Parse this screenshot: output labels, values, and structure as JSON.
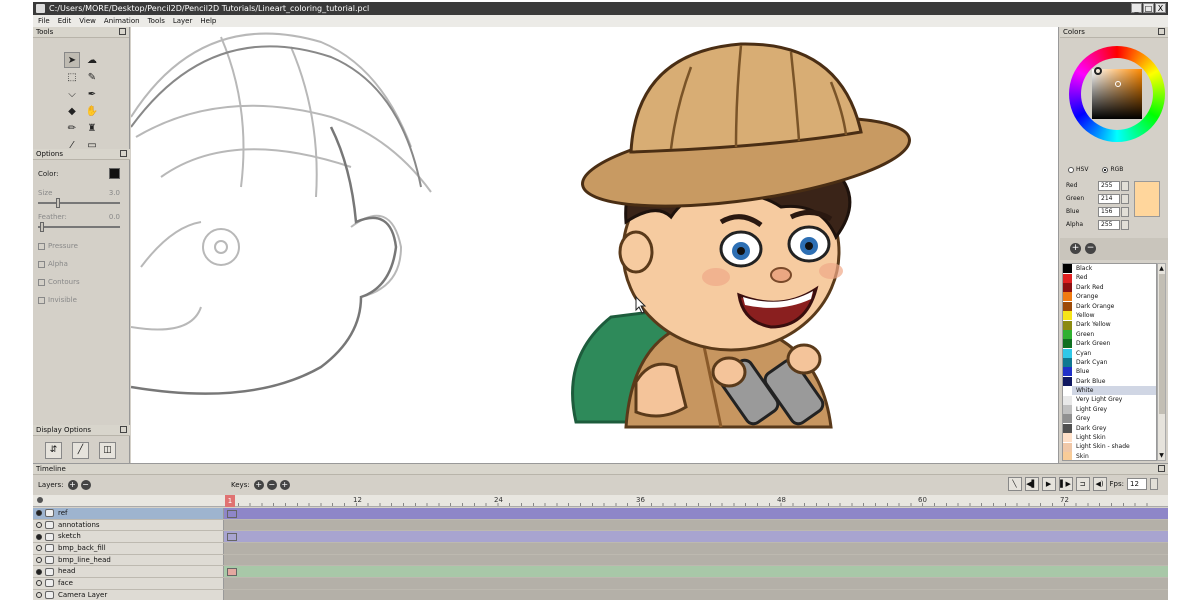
{
  "window": {
    "title": "C:/Users/MORE/Desktop/Pencil2D/Pencil2D Tutorials/Lineart_coloring_tutorial.pcl",
    "buttons": [
      "_",
      "□",
      "X"
    ]
  },
  "menu": [
    "File",
    "Edit",
    "View",
    "Animation",
    "Tools",
    "Layer",
    "Help"
  ],
  "tools_panel": {
    "title": "Tools",
    "tools": [
      {
        "name": "pointer",
        "icon": "arrow-icon",
        "glyph": "➤",
        "active": true
      },
      {
        "name": "smudge",
        "icon": "smudge-icon",
        "glyph": "☁",
        "active": false
      },
      {
        "name": "select",
        "icon": "select-icon",
        "glyph": "⬚",
        "active": false
      },
      {
        "name": "brush",
        "icon": "brush-icon",
        "glyph": "✎",
        "active": false
      },
      {
        "name": "polyline",
        "icon": "polyline-icon",
        "glyph": "⌵",
        "active": false
      },
      {
        "name": "pen",
        "icon": "pen-icon",
        "glyph": "✒",
        "active": false
      },
      {
        "name": "bucket",
        "icon": "bucket-icon",
        "glyph": "◆",
        "active": false
      },
      {
        "name": "hand",
        "icon": "hand-icon",
        "glyph": "✋",
        "active": false
      },
      {
        "name": "pencil",
        "icon": "pencil-icon",
        "glyph": "✏",
        "active": false
      },
      {
        "name": "stamp",
        "icon": "stamp-icon",
        "glyph": "♜",
        "active": false
      },
      {
        "name": "eyedropper",
        "icon": "eyedropper-icon",
        "glyph": "⁄",
        "active": false
      },
      {
        "name": "eraser",
        "icon": "eraser-icon",
        "glyph": "▭",
        "active": false
      }
    ]
  },
  "options_panel": {
    "title": "Options",
    "color_label": "Color:",
    "size_label": "Size",
    "size_value": "3.0",
    "feather_label": "Feather:",
    "feather_value": "0.0",
    "checks": [
      "Pressure",
      "Alpha",
      "Contours",
      "Invisible"
    ]
  },
  "display_options": {
    "title": "Display Options"
  },
  "colors_panel": {
    "title": "Colors",
    "mode_hsv": "HSV",
    "mode_rgb": "RGB",
    "red_label": "Red",
    "red_value": "255",
    "green_label": "Green",
    "green_value": "214",
    "blue_label": "Blue",
    "blue_value": "156",
    "alpha_label": "Alpha",
    "alpha_value": "255",
    "current_color": "#ffd69c"
  },
  "palette": [
    {
      "name": "Black",
      "color": "#000000"
    },
    {
      "name": "Red",
      "color": "#e02020"
    },
    {
      "name": "Dark Red",
      "color": "#8c1010"
    },
    {
      "name": "Orange",
      "color": "#f07a10"
    },
    {
      "name": "Dark Orange",
      "color": "#9c4a08"
    },
    {
      "name": "Yellow",
      "color": "#f6e418"
    },
    {
      "name": "Dark Yellow",
      "color": "#8c8a10"
    },
    {
      "name": "Green",
      "color": "#30b030"
    },
    {
      "name": "Dark Green",
      "color": "#107020"
    },
    {
      "name": "Cyan",
      "color": "#30c8e8"
    },
    {
      "name": "Dark Cyan",
      "color": "#107890"
    },
    {
      "name": "Blue",
      "color": "#2030c8"
    },
    {
      "name": "Dark Blue",
      "color": "#101860"
    },
    {
      "name": "White",
      "color": "#ffffff"
    },
    {
      "name": "Very Light Grey",
      "color": "#e8e8e8"
    },
    {
      "name": "Light Grey",
      "color": "#c0c0c0"
    },
    {
      "name": "Grey",
      "color": "#909090"
    },
    {
      "name": "Dark Grey",
      "color": "#505050"
    },
    {
      "name": "Light Skin",
      "color": "#ffe0c8"
    },
    {
      "name": "Light Skin - shade",
      "color": "#f0c8a8"
    },
    {
      "name": "Skin",
      "color": "#f8cc98"
    }
  ],
  "timeline": {
    "title": "Timeline",
    "layers_label": "Layers:",
    "keys_label": "Keys:",
    "fps_label": "Fps:",
    "fps_value": "12",
    "ruler_numbers": [
      "1",
      "12",
      "24",
      "36",
      "48",
      "60",
      "72"
    ],
    "layers": [
      {
        "name": "ref",
        "visible": true,
        "selected": true,
        "track": "#8e86c8",
        "key": "#8e86c8"
      },
      {
        "name": "annotations",
        "visible": false,
        "selected": false,
        "track": "#b4b0a8",
        "key": ""
      },
      {
        "name": "sketch",
        "visible": true,
        "selected": false,
        "track": "#a8a4d0",
        "key": "#a8a4d0"
      },
      {
        "name": "bmp_back_fill",
        "visible": false,
        "selected": false,
        "track": "#b4b0a8",
        "key": ""
      },
      {
        "name": "bmp_line_head",
        "visible": false,
        "selected": false,
        "track": "#b4b0a8",
        "key": ""
      },
      {
        "name": "head",
        "visible": true,
        "selected": false,
        "track": "#a8c8a8",
        "key": "#e4a8a0"
      },
      {
        "name": "face",
        "visible": false,
        "selected": false,
        "track": "#b4b0a8",
        "key": ""
      },
      {
        "name": "Camera Layer",
        "visible": false,
        "selected": false,
        "track": "#b4b0a8",
        "key": ""
      }
    ]
  }
}
